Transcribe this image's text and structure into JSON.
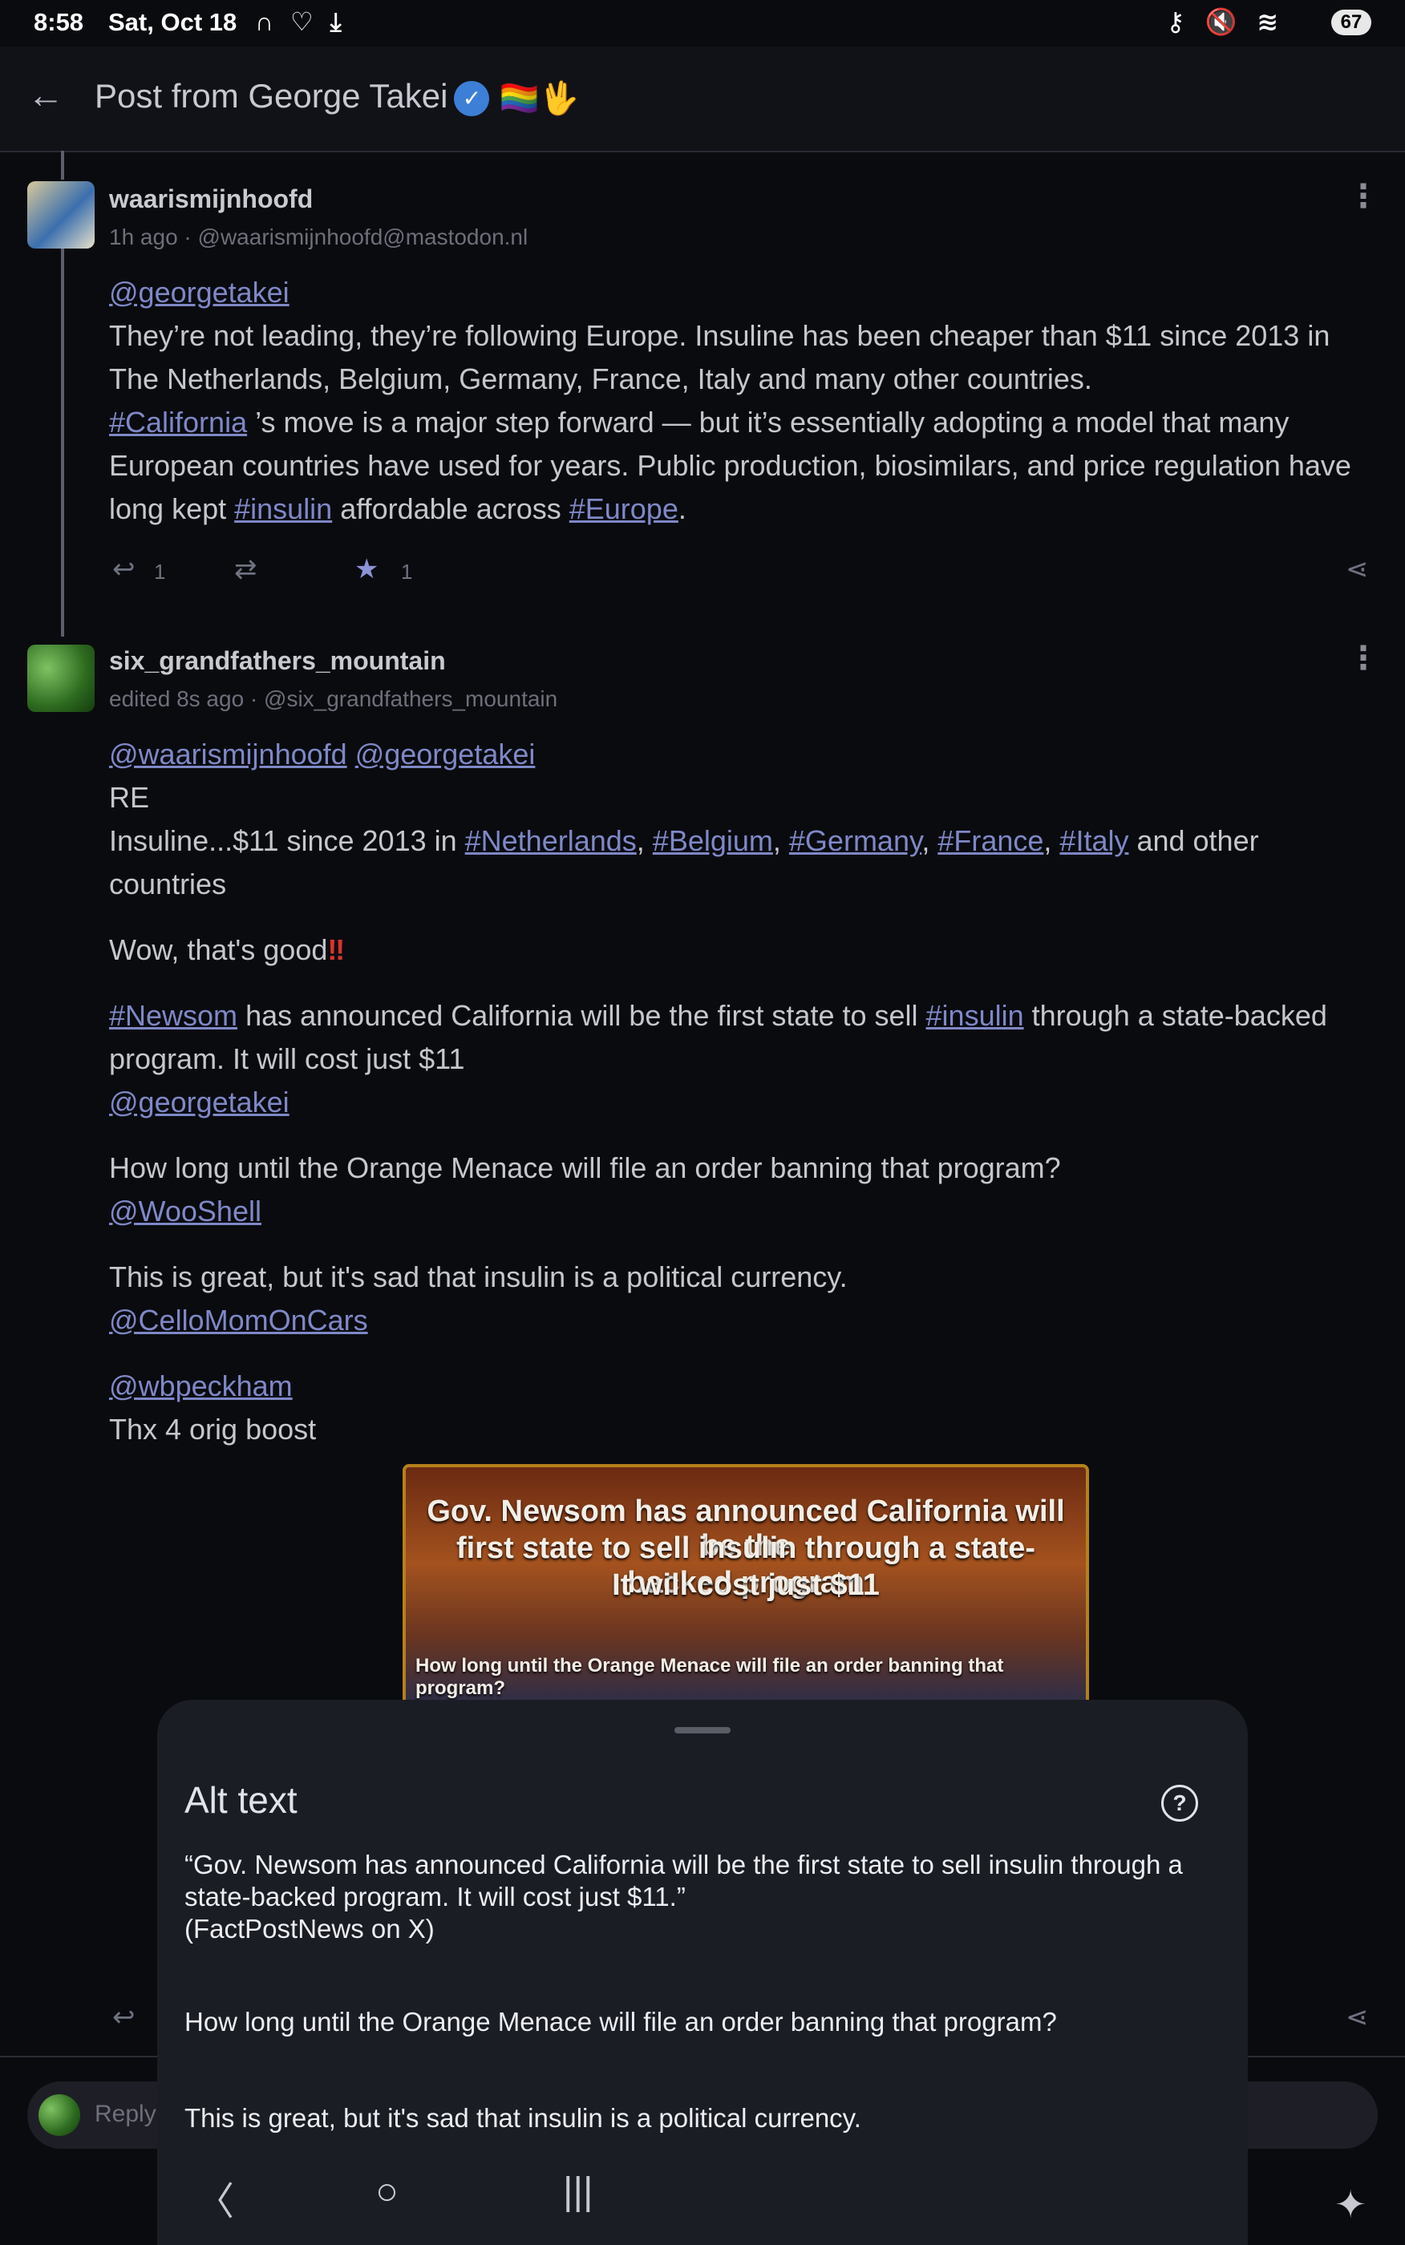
{
  "status_bar": {
    "time": "8:58",
    "date": "Sat, Oct 18",
    "left_icons": "∩ ♡ ⤓",
    "right_icons": "⚷ 🔇 ≋",
    "battery": "67"
  },
  "top_bar": {
    "back_icon": "←",
    "title": "Post from George Takei",
    "verified_icon": "✓",
    "title_emoji": "🏳️‍🌈🖖"
  },
  "posts": [
    {
      "name": "waarismijnhoofd",
      "meta": "1h ago · @waarismijnhoofd@mastodon.nl",
      "mention": "@georgetakei",
      "text_a": "They’re not leading, they’re following Europe. Insuline has been cheaper than $11 since 2013 in The Netherlands, Belgium, Germany, France, Italy and many other countries.",
      "tag_california": "#California",
      "text_b": " ’s move is a major step forward — but it’s essentially adopting a model that many European countries have used for years. Public production, biosimilars, and price regulation have long kept ",
      "tag_insulin": "#insulin",
      "text_c": " affordable across ",
      "tag_europe": "#Europe",
      "text_d": ".",
      "replies": "1",
      "favourites": "1"
    },
    {
      "name": "six_grandfathers_mountain",
      "meta": "edited 8s ago · @six_grandfathers_mountain",
      "mention1": "@waarismijnhoofd",
      "mention2": "@georgetakei",
      "re": "RE",
      "insuline_a": "Insuline...$11 since 2013 in ",
      "tag_nl": "#Netherlands",
      "tag_be": "#Belgium",
      "tag_de": "#Germany",
      "tag_fr": "#France",
      "tag_it": "#Italy",
      "insuline_b": " and other countries",
      "wow": "Wow, that's good",
      "wow_emoji": "‼",
      "tag_newsom": "#Newsom",
      "newsom_a": " has announced California will be the first state to sell ",
      "tag_insulin": "#insulin",
      "newsom_b": " through a state-backed program. It will cost just $11",
      "mention3": "@georgetakei",
      "orange": "How long until the Orange Menace will file an order banning that program?",
      "mention4": "@WooShell",
      "great": "This is great, but it's sad that insulin is a political currency.",
      "mention5": "@CelloMomOnCars",
      "mention6": "@wbpeckham",
      "thx": "Thx 4 orig boost"
    }
  ],
  "image": {
    "line1": "Gov. Newsom has announced California will be the",
    "line2": "first state to sell insulin through a state-backed program",
    "line3": "It will cost just $11",
    "line4": "How long until the Orange Menace will file an order banning that program?"
  },
  "alt_sheet": {
    "title": "Alt text",
    "help_icon": "?",
    "para1_l1": "“Gov. Newsom has announced California will be the first state to sell insulin through a",
    "para1_l2": "state-backed program. It will cost just $11.”",
    "para1_l3": "(FactPostNews on X)",
    "para2": "How long until the Orange Menace will file an order banning that program?",
    "para3": "This is great, but it's sad that insulin is a political currency."
  },
  "reply": {
    "placeholder": "Reply"
  },
  "nav": {
    "back": "〈",
    "home": "○",
    "recents": "|||",
    "accessibility": "✦"
  }
}
